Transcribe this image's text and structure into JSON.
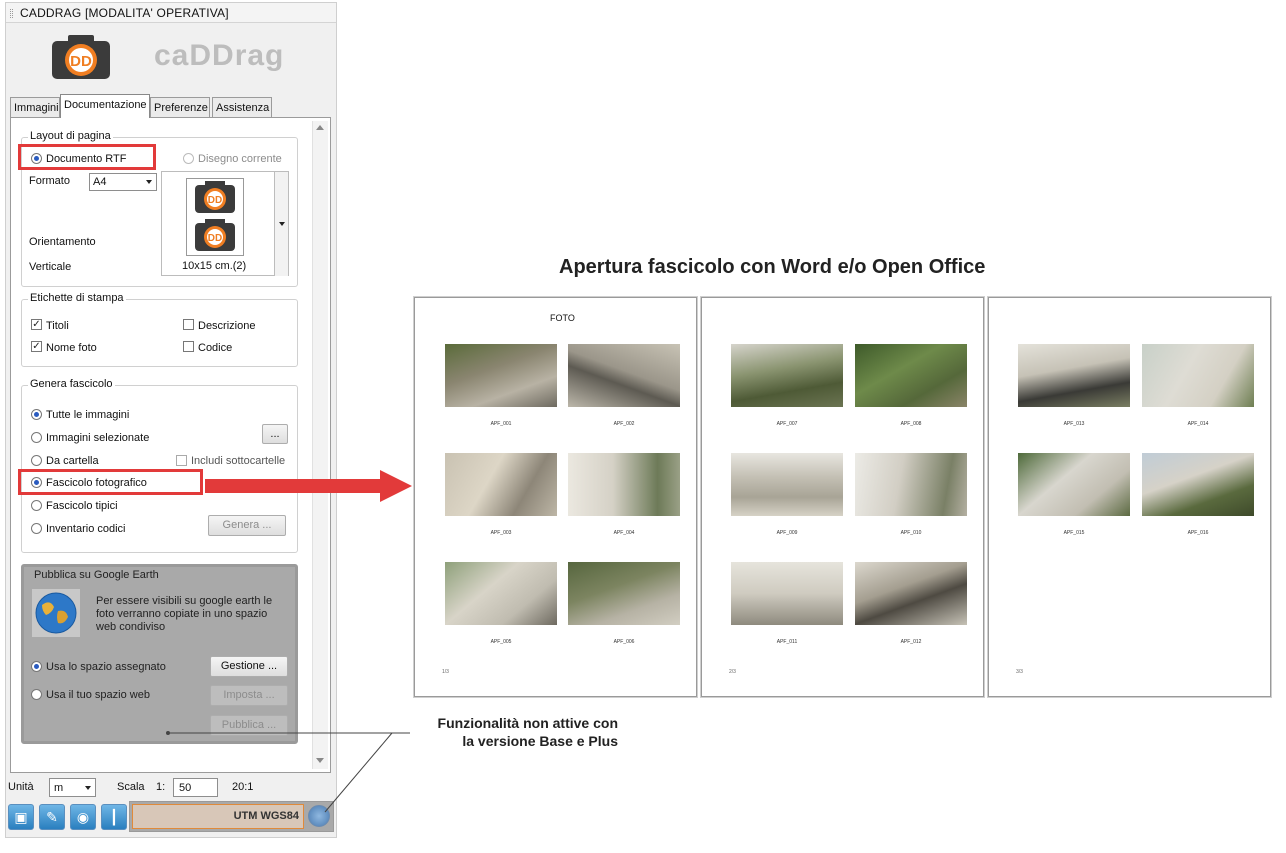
{
  "panel": {
    "title": "CADDRAG  [MODALITA' OPERATIVA]",
    "logo_text": "caDDrag",
    "tabs": [
      {
        "label": "Immagini"
      },
      {
        "label": "Documentazione"
      },
      {
        "label": "Preferenze"
      },
      {
        "label": "Assistenza"
      }
    ],
    "layout": {
      "title": "Layout di pagina",
      "doc_rtf": "Documento RTF",
      "disegno": "Disegno corrente",
      "formato_label": "Formato",
      "formato_value": "A4",
      "orientamento_label": "Orientamento",
      "orientamento_value": "Verticale",
      "preview_caption": "10x15 cm.(2)"
    },
    "etichette": {
      "title": "Etichette di stampa",
      "titoli": "Titoli",
      "nome_foto": "Nome foto",
      "descrizione": "Descrizione",
      "codice": "Codice"
    },
    "genera": {
      "title": "Genera fascicolo",
      "tutte": "Tutte le immagini",
      "selezionate": "Immagini selezionate",
      "browse": "...",
      "cartella": "Da cartella",
      "sottocartelle": "Includi sottocartelle",
      "fotografico": "Fascicolo fotografico",
      "tipici": "Fascicolo tipici",
      "inventario": "Inventario codici",
      "genera_btn": "Genera ..."
    },
    "google": {
      "title": "Pubblica su Google Earth",
      "desc": "Per essere visibili su google earth le foto verranno copiate in uno spazio web condiviso",
      "spazio_assegnato": "Usa lo spazio assegnato",
      "gestione_btn": "Gestione ...",
      "tuo_spazio": "Usa il tuo spazio web",
      "imposta_btn": "Imposta ...",
      "pubblica_btn": "Pubblica ..."
    },
    "bottom": {
      "unita_label": "Unità",
      "unita_value": "m",
      "scala_label": "Scala",
      "scala_prefix": "1:",
      "scala_value": "50",
      "ratio": "20:1",
      "coord_system": "UTM WGS84"
    }
  },
  "preview": {
    "heading": "Apertura fascicolo con Word e/o Open Office",
    "page1_title": "FOTO",
    "pages": [
      {
        "number": "1/3",
        "photos": [
          "APF_001",
          "APF_002",
          "APF_003",
          "APF_004",
          "APF_005",
          "APF_006"
        ]
      },
      {
        "number": "2/3",
        "photos": [
          "APF_007",
          "APF_008",
          "APF_009",
          "APF_010",
          "APF_011",
          "APF_012"
        ]
      },
      {
        "number": "3/3",
        "photos": [
          "APF_013",
          "APF_014",
          "APF_015",
          "APF_016"
        ]
      }
    ]
  },
  "annotation": {
    "line1": "Funzionalità non attive con",
    "line2": "la versione Base e Plus"
  },
  "colors": {
    "highlight_red": "#e23a3a",
    "disabled_overlay": "#a8a8a8",
    "coord_box": "#d8c7b8"
  }
}
